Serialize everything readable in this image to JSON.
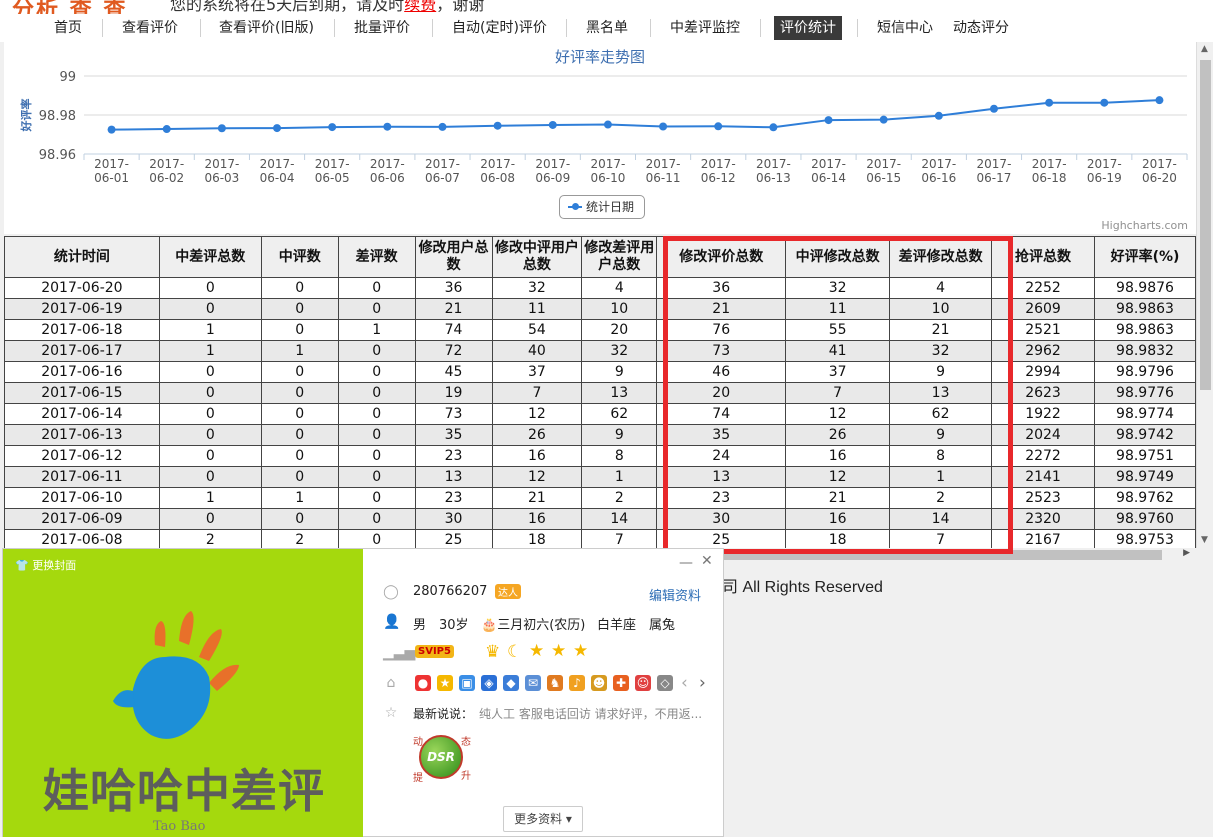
{
  "top": {
    "logo_fragment": "分析 查 查",
    "notice_prefix": "您的系统将在5天后到期，请及时",
    "notice_link": "续费",
    "notice_suffix": "，谢谢"
  },
  "nav": {
    "items": [
      {
        "label": "首页",
        "active": false
      },
      {
        "label": "查看评价",
        "active": false
      },
      {
        "label": "查看评价(旧版)",
        "active": false
      },
      {
        "label": "批量评价",
        "active": false
      },
      {
        "label": "自动(定时)评价",
        "active": false
      },
      {
        "label": "黑名单",
        "active": false
      },
      {
        "label": "中差评监控",
        "active": false
      },
      {
        "label": "评价统计",
        "active": true
      },
      {
        "label": "短信中心",
        "active": false
      },
      {
        "label": "动态评分",
        "active": false
      }
    ]
  },
  "chart_data": {
    "type": "line",
    "title": "好评率走势图",
    "ylabel": "好评率",
    "xlabel": "",
    "categories": [
      "2017-06-01",
      "2017-06-02",
      "2017-06-03",
      "2017-06-04",
      "2017-06-05",
      "2017-06-06",
      "2017-06-07",
      "2017-06-08",
      "2017-06-09",
      "2017-06-10",
      "2017-06-11",
      "2017-06-12",
      "2017-06-13",
      "2017-06-14",
      "2017-06-15",
      "2017-06-16",
      "2017-06-17",
      "2017-06-18",
      "2017-06-19",
      "2017-06-20"
    ],
    "series": [
      {
        "name": "统计日期",
        "color": "#2f7ed8",
        "values": [
          98.9725,
          98.9728,
          98.9732,
          98.9733,
          98.9738,
          98.974,
          98.9739,
          98.9745,
          98.9749,
          98.9751,
          98.9741,
          98.9742,
          98.9737,
          98.9774,
          98.9776,
          98.9796,
          98.9832,
          98.9863,
          98.9863,
          98.9876
        ]
      }
    ],
    "ylim": [
      98.96,
      99.0
    ],
    "yticks": [
      "99",
      "98.98",
      "98.96"
    ],
    "grid": true,
    "legend": "bottom-center",
    "credits": "Highcharts.com"
  },
  "table": {
    "headers": [
      "统计时间",
      "中差评总数",
      "中评数",
      "差评数",
      "修改用户总数",
      "修改中评用户总数",
      "修改差评用户总数",
      "修改评价总数",
      "中评修改总数",
      "差评修改总数",
      "抢评总数",
      "好评率(%)"
    ],
    "rows": [
      [
        "2017-06-20",
        "0",
        "0",
        "0",
        "36",
        "32",
        "4",
        "36",
        "32",
        "4",
        "2252",
        "98.9876"
      ],
      [
        "2017-06-19",
        "0",
        "0",
        "0",
        "21",
        "11",
        "10",
        "21",
        "11",
        "10",
        "2609",
        "98.9863"
      ],
      [
        "2017-06-18",
        "1",
        "0",
        "1",
        "74",
        "54",
        "20",
        "76",
        "55",
        "21",
        "2521",
        "98.9863"
      ],
      [
        "2017-06-17",
        "1",
        "1",
        "0",
        "72",
        "40",
        "32",
        "73",
        "41",
        "32",
        "2962",
        "98.9832"
      ],
      [
        "2017-06-16",
        "0",
        "0",
        "0",
        "45",
        "37",
        "9",
        "46",
        "37",
        "9",
        "2994",
        "98.9796"
      ],
      [
        "2017-06-15",
        "0",
        "0",
        "0",
        "19",
        "7",
        "13",
        "20",
        "7",
        "13",
        "2623",
        "98.9776"
      ],
      [
        "2017-06-14",
        "0",
        "0",
        "0",
        "73",
        "12",
        "62",
        "74",
        "12",
        "62",
        "1922",
        "98.9774"
      ],
      [
        "2017-06-13",
        "0",
        "0",
        "0",
        "35",
        "26",
        "9",
        "35",
        "26",
        "9",
        "2024",
        "98.9742"
      ],
      [
        "2017-06-12",
        "0",
        "0",
        "0",
        "23",
        "16",
        "8",
        "24",
        "16",
        "8",
        "2272",
        "98.9751"
      ],
      [
        "2017-06-11",
        "0",
        "0",
        "0",
        "13",
        "12",
        "1",
        "13",
        "12",
        "1",
        "2141",
        "98.9749"
      ],
      [
        "2017-06-10",
        "1",
        "1",
        "0",
        "23",
        "21",
        "2",
        "23",
        "21",
        "2",
        "2523",
        "98.9762"
      ],
      [
        "2017-06-09",
        "0",
        "0",
        "0",
        "30",
        "16",
        "14",
        "30",
        "16",
        "14",
        "2320",
        "98.9760"
      ],
      [
        "2017-06-08",
        "2",
        "2",
        "0",
        "25",
        "18",
        "7",
        "25",
        "18",
        "7",
        "2167",
        "98.9753"
      ]
    ],
    "highlight_color": "#e8282b"
  },
  "footer": {
    "copyright_fragment": "司 All Rights Reserved"
  },
  "profile": {
    "change_cover": "更换封面",
    "cover_text": "娃哈哈中差评",
    "cover_sub": "Tao Bao",
    "qq": "280766207",
    "qq_badge": "达人",
    "edit_link": "编辑资料",
    "gender": "男",
    "age": "30岁",
    "birthday": "三月初六(农历)",
    "zodiac": "白羊座",
    "shengxiao": "属兔",
    "svip": "SVIP5",
    "status_label": "最新说说：",
    "status_text": "纯人工 客服电话回访 请求好评，不用返...",
    "dsr_label": "DSR",
    "dsr_chars": [
      "动",
      "态",
      "提",
      "升"
    ],
    "more_button": "更多资料 ▾"
  }
}
